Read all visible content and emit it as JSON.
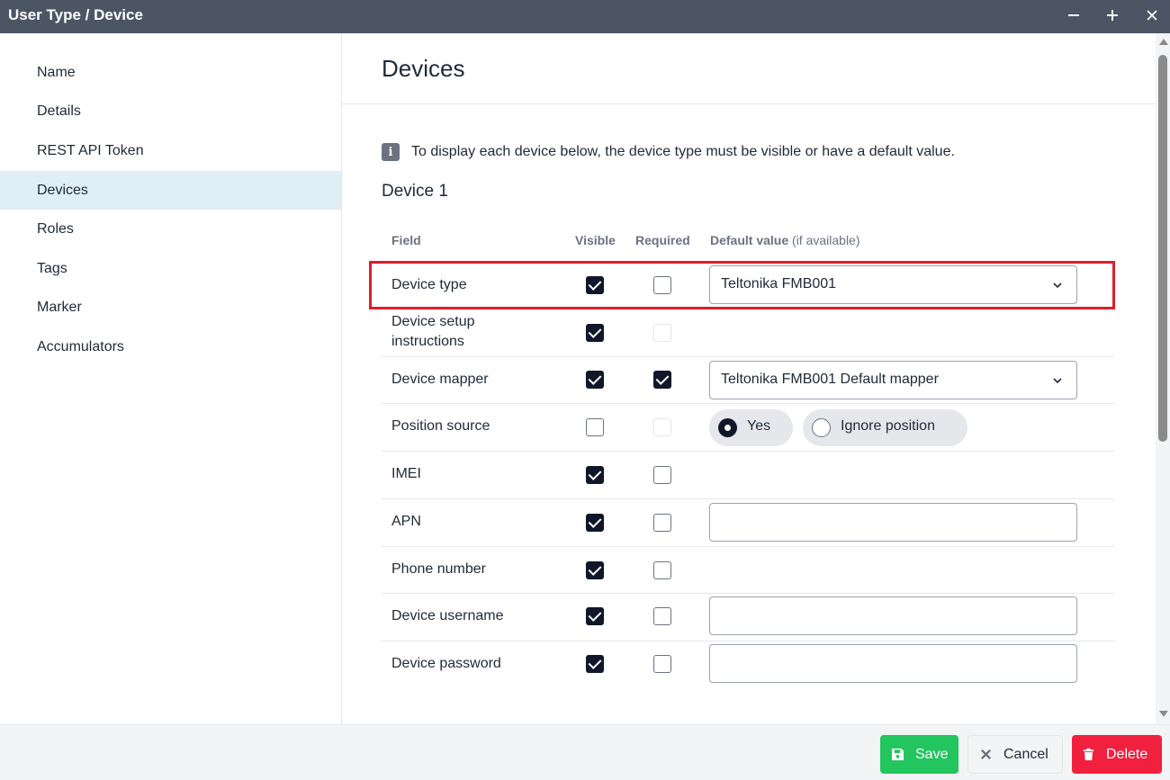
{
  "window": {
    "title": "User Type / Device",
    "minimize_icon": "minus-icon",
    "maximize_icon": "plus-icon",
    "close_icon": "close-icon"
  },
  "sidebar": {
    "items": [
      {
        "label": "Name",
        "active": false
      },
      {
        "label": "Details",
        "active": false
      },
      {
        "label": "REST API Token",
        "active": false
      },
      {
        "label": "Devices",
        "active": true
      },
      {
        "label": "Roles",
        "active": false
      },
      {
        "label": "Tags",
        "active": false
      },
      {
        "label": "Marker",
        "active": false
      },
      {
        "label": "Accumulators",
        "active": false
      }
    ]
  },
  "main": {
    "title": "Devices",
    "info_text": "To display each device below, the device type must be visible or have a default value.",
    "info_icon": "i",
    "device_heading": "Device 1",
    "columns": {
      "field": "Field",
      "visible": "Visible",
      "required": "Required",
      "default": "Default value",
      "default_hint": "(if available)"
    },
    "rows": [
      {
        "label": "Device type",
        "visible": "checked",
        "required": "unchecked",
        "default_type": "select",
        "default_value": "Teltonika FMB001"
      },
      {
        "label": "Device setup instructions",
        "visible": "checked",
        "required": "disabled",
        "default_type": "none"
      },
      {
        "label": "Device mapper",
        "visible": "checked",
        "required": "checked",
        "default_type": "select",
        "default_value": "Teltonika FMB001 Default mapper"
      },
      {
        "label": "Position source",
        "visible": "unchecked",
        "required": "disabled",
        "default_type": "radio",
        "options": [
          "Yes",
          "Ignore position"
        ],
        "selected": "Yes"
      },
      {
        "label": "IMEI",
        "visible": "checked",
        "required": "unchecked",
        "default_type": "none"
      },
      {
        "label": "APN",
        "visible": "checked",
        "required": "unchecked",
        "default_type": "text",
        "default_value": ""
      },
      {
        "label": "Phone number",
        "visible": "checked",
        "required": "unchecked",
        "default_type": "none"
      },
      {
        "label": "Device username",
        "visible": "checked",
        "required": "unchecked",
        "default_type": "text",
        "default_value": ""
      },
      {
        "label": "Device password",
        "visible": "checked",
        "required": "unchecked",
        "default_type": "text",
        "default_value": ""
      }
    ]
  },
  "footer": {
    "save_label": "Save",
    "cancel_label": "Cancel",
    "delete_label": "Delete",
    "save_icon": "floppy-disk-icon",
    "cancel_icon": "x-icon",
    "delete_icon": "trash-icon"
  },
  "colors": {
    "titlebar": "#4b5563",
    "active_nav": "#e0eef8",
    "save": "#22c55e",
    "delete": "#f0203e",
    "highlight": "#e11d2a",
    "checkbox_checked": "#0f1729"
  }
}
